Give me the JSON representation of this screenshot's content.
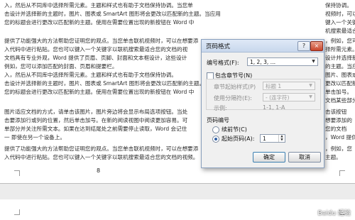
{
  "document": {
    "lines": [
      "入，然后从不同库中选择所需元素。主题和样式也有助于文档保持协调。当您单",
      "击设计并选择新的主题时，图片、图表或 SmartArt 图形将会更改以匹配新的主题。当应用",
      "您的标题会进行更改以匹配新的主题。使用在需要位置出现的新按钮在 Word 中",
      "",
      "提供了功能强大的方法帮助您证明您的观点。当您单击联机视频时，可以在想要添",
      "入代码中进行粘贴。您也可以键入一个关键字以联机搜索最适合您的文档的视",
      "文档具有专业外观，Word 提供了页眉、页脚、封面和文本框设计，这些设计",
      "例如，您可以添加匹配的封面、页眉和提要栏。",
      "入，然后从不同库中选择所需元素。主题和样式也有助于文档保持协调。",
      "击设计并选择新的主题时，图片、图表或 SmartArt 图形将会更改以匹配新的主题。",
      "您的标题会进行更改以匹配新的主题。使用在需要位置出现的新按钮在 Word 中",
      "",
      "图片适应文档的方式，请单击该图片，图片旁边将会显示布局选项按钮。当处",
      "击要添加行或列的位置，然后单击加号。在新的阅读视图中阅读更加容易。可",
      "单部分并关注所需文本。如果在达到结尾处之前需要停止读取，Word 会记住",
      "一 即使在另一个设备上。",
      "提供了功能强大的方法帮助您证明您的观点。当您单击联机视频时，可以在想要添",
      "入代码中进行粘贴。您也可以键入一个关键字以联机搜索最适合您的文档的视频。"
    ],
    "right_lines": [
      "保持协调。",
      "视频时，可以",
      "键入一个关键字",
      "机搜索最适合您",
      "，例如，您可以",
      "择所需元素。",
      "设计并选择新的",
      "的主题。当应",
      "图片、图表或",
      "更改以匹配新",
      "单击加号。",
      "文档某些部分",
      "击该按钮",
      "想要添加的",
      "您的文档",
      "，Word 提供",
      "，例如，您",
      "主题。"
    ],
    "page_number": "8"
  },
  "dialog": {
    "title": "页码格式",
    "help_glyph": "?",
    "close_glyph": "×",
    "number_format_label": "编号格式(F):",
    "number_format_value": "1, 2, 3, …",
    "include_chapter_label": "包含章节号(N)",
    "chapter_style_label": "章节起始样式(P)",
    "chapter_style_value": "标题 1",
    "separator_label": "使用分隔符(E):",
    "separator_value": "-  (连字符)",
    "examples_label": "示例:",
    "examples_value": "1-1, 1-A",
    "numbering_group_label": "页码编号",
    "continue_label": "续前节(C)",
    "start_at_label": "起始页码(A):",
    "start_at_value": "1",
    "ok_label": "确定",
    "cancel_label": "取消"
  },
  "watermark": "Baidu 经验",
  "colors": {
    "title_bar": "#c8d7ec",
    "close_button": "#c9452b",
    "dialog_bg": "#f0f0f0",
    "gap": "#ececec"
  }
}
